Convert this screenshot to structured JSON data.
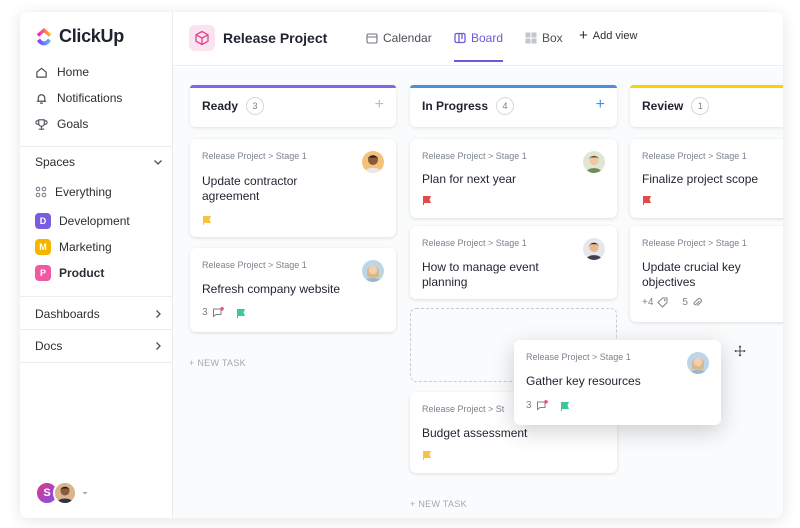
{
  "app": {
    "name": "ClickUp"
  },
  "sidebar": {
    "nav": [
      {
        "label": "Home",
        "icon": "home-icon"
      },
      {
        "label": "Notifications",
        "icon": "bell-icon"
      },
      {
        "label": "Goals",
        "icon": "trophy-icon"
      }
    ],
    "spaces_label": "Spaces",
    "everything_label": "Everything",
    "spaces": [
      {
        "label": "Development",
        "badge": "D",
        "color": "#7b5bde"
      },
      {
        "label": "Marketing",
        "badge": "M",
        "color": "#f5b400"
      },
      {
        "label": "Product",
        "badge": "P",
        "color": "#ef5aa0"
      }
    ],
    "dashboards_label": "Dashboards",
    "docs_label": "Docs",
    "user_initial": "S"
  },
  "header": {
    "project_title": "Release Project",
    "views": [
      {
        "label": "Calendar",
        "icon": "calendar-icon"
      },
      {
        "label": "Board",
        "icon": "board-icon"
      },
      {
        "label": "Box",
        "icon": "box-grid-icon"
      }
    ],
    "add_view_label": "Add view"
  },
  "board": {
    "columns": [
      {
        "title": "Ready",
        "count": "3",
        "color": "#7b68ee",
        "cards": [
          {
            "path": "Release Project > Stage 1",
            "title_line1": "Update contractor",
            "title_line2": "agreement",
            "flag_color": "#f5c542"
          },
          {
            "path": "Release Project > Stage 1",
            "title_line1": "Refresh company website",
            "comments": "3",
            "flag_color": "#3ec79b"
          }
        ],
        "new_task": "+ NEW TASK"
      },
      {
        "title": "In Progress",
        "count": "4",
        "color": "#4a90e2",
        "cards": [
          {
            "path": "Release Project > Stage 1",
            "title_line1": "Plan for next year",
            "flag_color": "#e8484a"
          },
          {
            "path": "Release Project > Stage 1",
            "title_line1": "How to manage event",
            "title_line2": "planning"
          },
          {
            "path": "Release Project > Stage 1",
            "title_line1": "Budget assessment",
            "flag_color": "#f5c542"
          }
        ],
        "new_task": "+ NEW TASK"
      },
      {
        "title": "Review",
        "count": "1",
        "color": "#f5d400",
        "cards": [
          {
            "path": "Release Project > Stage 1",
            "title_line1": "Finalize project scope",
            "flag_color": "#e8484a"
          },
          {
            "path": "Release Project > Stage 1",
            "title_line1": "Update crucial key",
            "title_line2": "objectives",
            "tags": "+4",
            "attachments": "5"
          }
        ]
      }
    ],
    "dragged_card": {
      "path": "Release Project > Stage 1",
      "title": "Gather key resources",
      "comments": "3",
      "flag_color": "#3ec79b"
    },
    "partial_path": "Release Project > St"
  }
}
